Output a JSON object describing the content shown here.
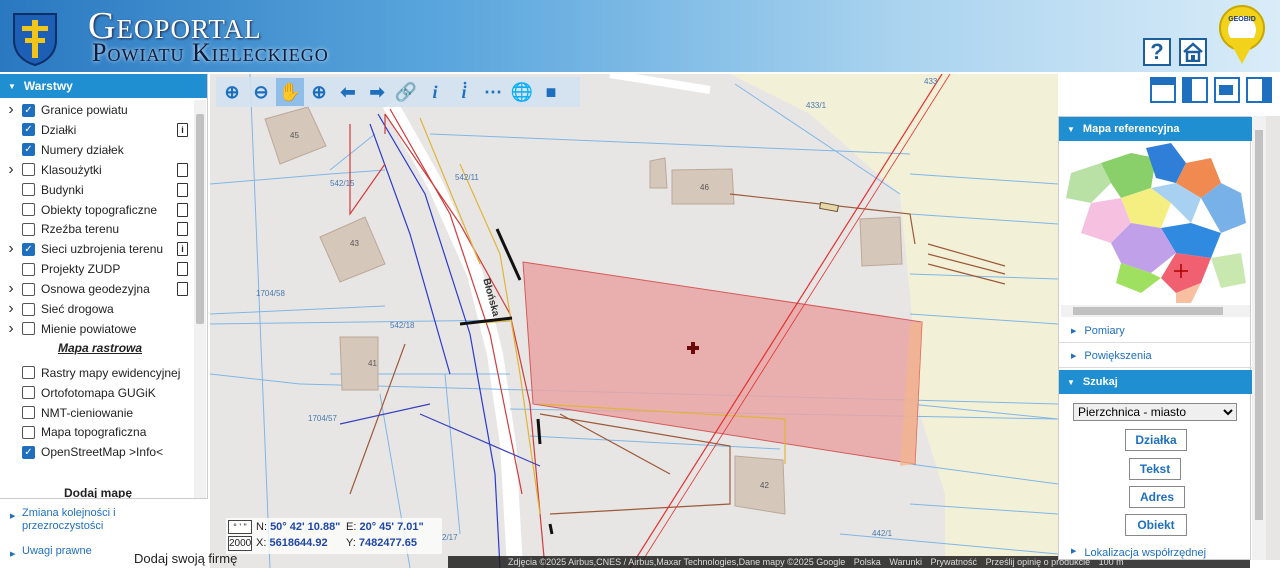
{
  "header": {
    "title_line1": "Geoportal",
    "title_line2": "Powiatu Kieleckiego",
    "help_label": "?",
    "geobid_label": "GEOBID"
  },
  "layers_panel": {
    "title": "Warstwy",
    "items": [
      {
        "label": "Granice powiatu",
        "checked": true,
        "expandable": true,
        "doc": ""
      },
      {
        "label": "Działki",
        "checked": true,
        "expandable": false,
        "doc": "i"
      },
      {
        "label": "Numery działek",
        "checked": true,
        "expandable": false,
        "doc": ""
      },
      {
        "label": "Klasoużytki",
        "checked": false,
        "expandable": true,
        "doc": " "
      },
      {
        "label": "Budynki",
        "checked": false,
        "expandable": false,
        "doc": " "
      },
      {
        "label": "Obiekty topograficzne",
        "checked": false,
        "expandable": false,
        "doc": " "
      },
      {
        "label": "Rzeźba terenu",
        "checked": false,
        "expandable": false,
        "doc": " "
      },
      {
        "label": "Sieci uzbrojenia terenu",
        "checked": true,
        "expandable": true,
        "doc": "i"
      },
      {
        "label": "Projekty ZUDP",
        "checked": false,
        "expandable": false,
        "doc": " "
      },
      {
        "label": "Osnowa geodezyjna",
        "checked": false,
        "expandable": true,
        "doc": " "
      },
      {
        "label": "Sieć drogowa",
        "checked": false,
        "expandable": true,
        "doc": ""
      },
      {
        "label": "Mienie powiatowe",
        "checked": false,
        "expandable": true,
        "doc": ""
      }
    ],
    "raster_heading": "Mapa rastrowa",
    "raster_items": [
      {
        "label": "Rastry mapy ewidencyjnej",
        "checked": false
      },
      {
        "label": "Ortofotomapa GUGiK",
        "checked": false
      },
      {
        "label": "NMT-cieniowanie",
        "checked": false
      },
      {
        "label": "Mapa topograficzna",
        "checked": false
      },
      {
        "label": "OpenStreetMap >Info<",
        "checked": true
      }
    ],
    "add_map": "Dodaj mapę",
    "order_link": "Zmiana kolejności i przezroczystości",
    "legal_link": "Uwagi prawne"
  },
  "map": {
    "parcel_labels": [
      "433",
      "433/1",
      "542/15",
      "542/11",
      "45",
      "46",
      "43",
      "41",
      "42",
      "1704/58",
      "542/18",
      "1704/57",
      "442/1",
      "2/17"
    ],
    "street_label": "Błońska"
  },
  "coords": {
    "format_deg": "° ' \"",
    "format_2000": "2000",
    "n_label": "N:",
    "n_value": "50° 42' 10.88\"",
    "e_label": "E:",
    "e_value": "20° 45' 7.01\"",
    "x_label": "X:",
    "x_value": "5618644.92",
    "y_label": "Y:",
    "y_value": "7482477.65"
  },
  "attribution": {
    "imagery": "Zdjęcia ©2025 Airbus,CNES / Airbus,Maxar Technologies,Dane mapy ©2025 Google",
    "country": "Polska",
    "terms": "Warunki",
    "privacy": "Prywatność",
    "feedback": "Prześlij opinię o produkcie",
    "scale": "100 m"
  },
  "add_business": "Dodaj swoją firmę",
  "right_panel": {
    "refmap_title": "Mapa referencyjna",
    "measure": "Pomiary",
    "zoom": "Powiększenia",
    "search_title": "Szukaj",
    "city": "Pierzchnica - miasto",
    "btn_parcel": "Działka",
    "btn_text": "Tekst",
    "btn_address": "Adres",
    "btn_object": "Obiekt",
    "coords_locate": "Lokalizacja współrzędnej"
  },
  "colors": {
    "accent": "#1f8fd1",
    "parcel_highlight": "#e9a5a5",
    "power_line": "#e53030"
  }
}
